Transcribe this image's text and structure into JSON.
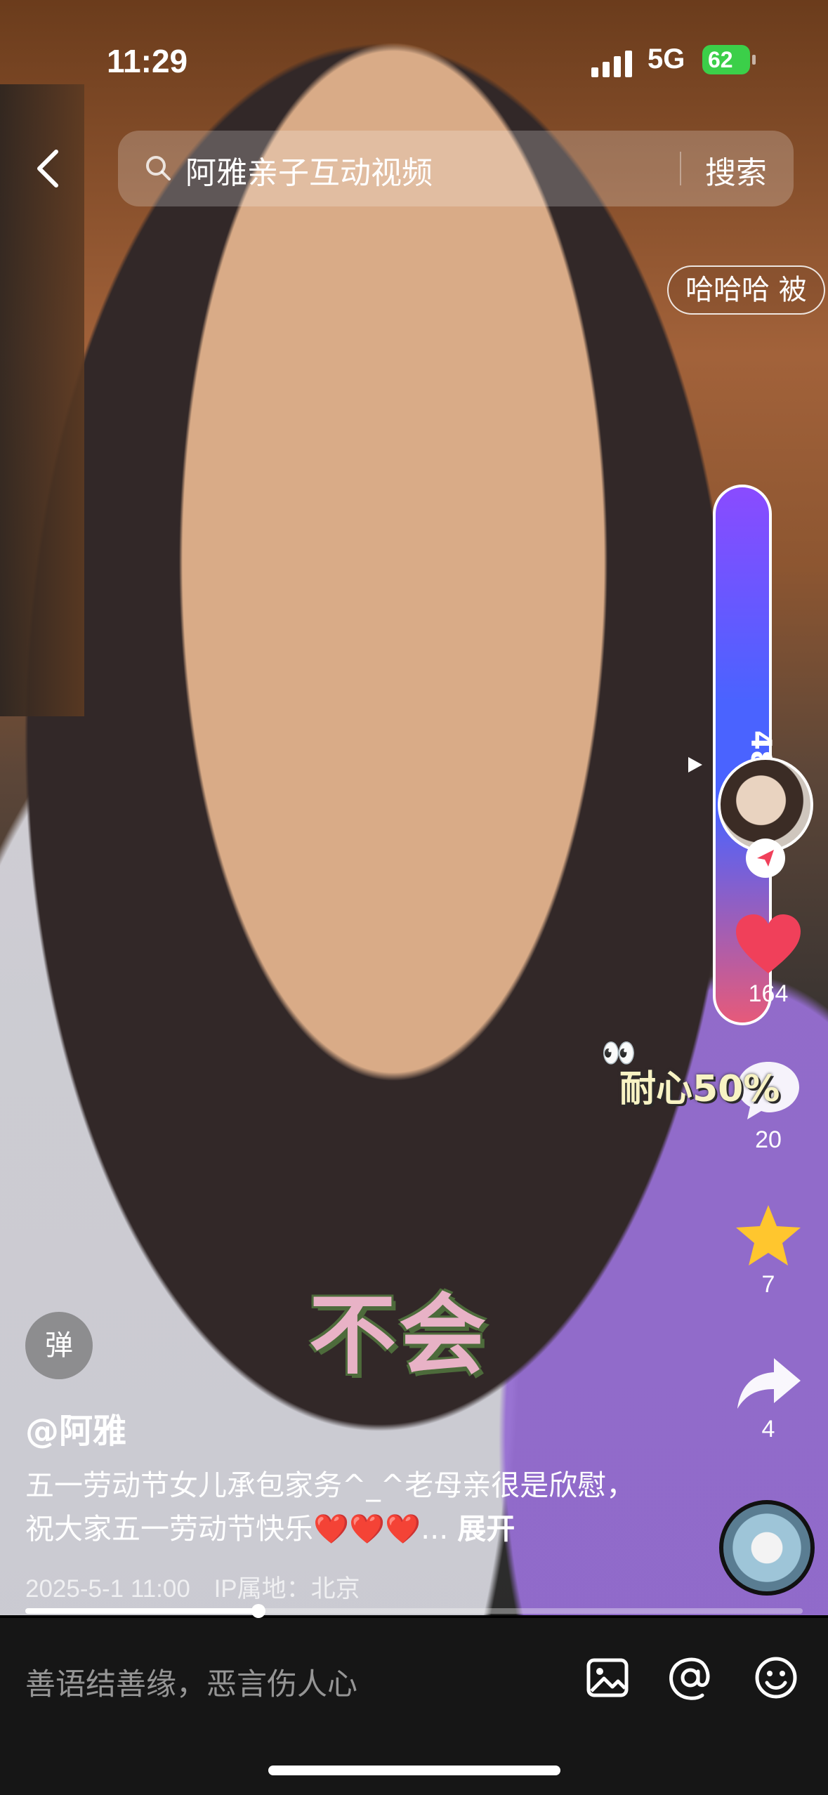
{
  "status_bar": {
    "time": "11:29",
    "network": "5G",
    "battery": "62"
  },
  "search": {
    "query": "阿雅亲子互动视频",
    "button_label": "搜索"
  },
  "danmaku": {
    "text": "哈哈哈 被"
  },
  "progress_pill": {
    "count": "48"
  },
  "actions": {
    "like_count": "164",
    "comment_count": "20",
    "favorite_count": "7",
    "share_count": "4"
  },
  "sticker": {
    "text": "耐心50%"
  },
  "subtitle": {
    "text": "不会"
  },
  "danmu_toggle": {
    "label": "弹"
  },
  "post": {
    "author": "@阿雅",
    "caption": "五一劳动节女儿承包家务^_^老母亲很是欣慰，祝大家五一劳动节快乐❤️❤️❤️...",
    "expand_label": "展开",
    "date": "2025-5-1 11:00",
    "ip_location": "IP属地：北京"
  },
  "playback": {
    "progress_fraction": 0.3
  },
  "comment_bar": {
    "placeholder": "善语结善缘，恶言伤人心"
  },
  "colors": {
    "like": "#f0405a",
    "favorite": "#ffc62e",
    "battery": "#3bcf49"
  }
}
